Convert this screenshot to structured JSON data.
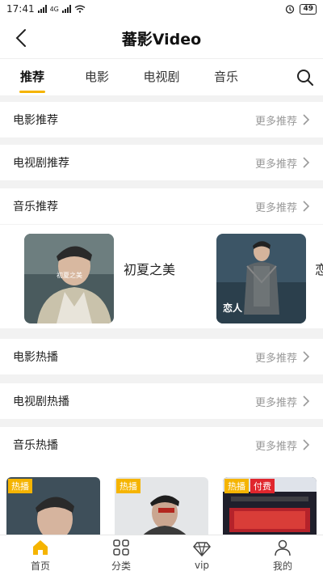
{
  "status": {
    "time": "17:41",
    "network": "4G",
    "battery": "49"
  },
  "header": {
    "title": "蕃影Video"
  },
  "tabs": [
    {
      "label": "推荐",
      "active": true
    },
    {
      "label": "电影",
      "active": false
    },
    {
      "label": "电视剧",
      "active": false
    },
    {
      "label": "音乐",
      "active": false
    }
  ],
  "sections": {
    "movie_rec": {
      "title": "电影推荐",
      "more": "更多推荐"
    },
    "tv_rec": {
      "title": "电视剧推荐",
      "more": "更多推荐"
    },
    "music_rec": {
      "title": "音乐推荐",
      "more": "更多推荐"
    },
    "movie_hot": {
      "title": "电影热播",
      "more": "更多推荐"
    },
    "tv_hot": {
      "title": "电视剧热播",
      "more": "更多推荐"
    },
    "music_hot": {
      "title": "音乐热播",
      "more": "更多推荐"
    }
  },
  "music_items": [
    {
      "name": "初夏之美",
      "cover_text": "初夏之美"
    },
    {
      "name": "恋",
      "cover_text": "恋人"
    }
  ],
  "hot_items": [
    {
      "badge": "热播",
      "paid": ""
    },
    {
      "badge": "热播",
      "paid": ""
    },
    {
      "badge": "热播",
      "paid": "付费"
    }
  ],
  "bottom_nav": [
    {
      "label": "首页",
      "icon": "home-icon",
      "active": true
    },
    {
      "label": "分类",
      "icon": "category-icon",
      "active": false
    },
    {
      "label": "vip",
      "icon": "diamond-icon",
      "active": false
    },
    {
      "label": "我的",
      "icon": "user-icon",
      "active": false
    }
  ],
  "colors": {
    "accent": "#f5b400",
    "paid": "#e0262d"
  }
}
